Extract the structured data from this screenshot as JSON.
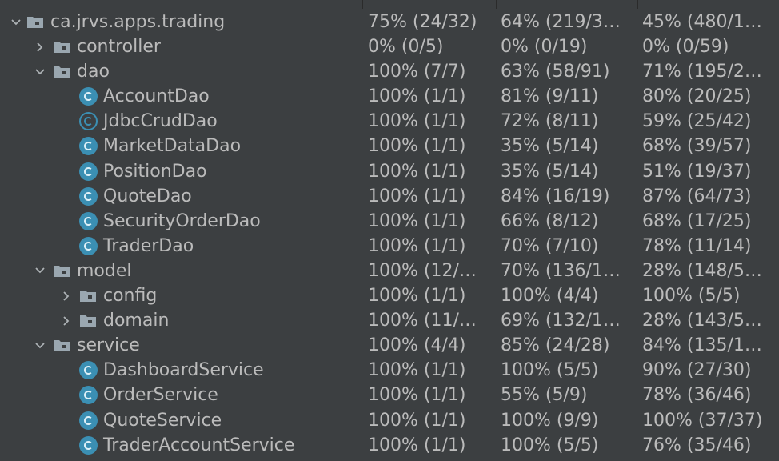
{
  "rows": [
    {
      "level": 0,
      "kind": "package",
      "expander": "expanded",
      "name": "ca.jrvs.apps.trading",
      "class_cov": "75% (24/32)",
      "method_cov": "64% (219/3…",
      "line_cov": "45% (480/1…"
    },
    {
      "level": 1,
      "kind": "package",
      "expander": "collapsed",
      "name": "controller",
      "class_cov": "0% (0/5)",
      "method_cov": "0% (0/19)",
      "line_cov": "0% (0/59)"
    },
    {
      "level": 1,
      "kind": "package",
      "expander": "expanded",
      "name": "dao",
      "class_cov": "100% (7/7)",
      "method_cov": "63% (58/91)",
      "line_cov": "71% (195/2…"
    },
    {
      "level": 2,
      "kind": "class",
      "name": "AccountDao",
      "class_cov": "100% (1/1)",
      "method_cov": "81% (9/11)",
      "line_cov": "80% (20/25)"
    },
    {
      "level": 2,
      "kind": "abstract-class",
      "name": "JdbcCrudDao",
      "class_cov": "100% (1/1)",
      "method_cov": "72% (8/11)",
      "line_cov": "59% (25/42)"
    },
    {
      "level": 2,
      "kind": "class",
      "name": "MarketDataDao",
      "class_cov": "100% (1/1)",
      "method_cov": "35% (5/14)",
      "line_cov": "68% (39/57)"
    },
    {
      "level": 2,
      "kind": "class",
      "name": "PositionDao",
      "class_cov": "100% (1/1)",
      "method_cov": "35% (5/14)",
      "line_cov": "51% (19/37)"
    },
    {
      "level": 2,
      "kind": "class",
      "name": "QuoteDao",
      "class_cov": "100% (1/1)",
      "method_cov": "84% (16/19)",
      "line_cov": "87% (64/73)"
    },
    {
      "level": 2,
      "kind": "class",
      "name": "SecurityOrderDao",
      "class_cov": "100% (1/1)",
      "method_cov": "66% (8/12)",
      "line_cov": "68% (17/25)"
    },
    {
      "level": 2,
      "kind": "class",
      "name": "TraderDao",
      "class_cov": "100% (1/1)",
      "method_cov": "70% (7/10)",
      "line_cov": "78% (11/14)"
    },
    {
      "level": 1,
      "kind": "package",
      "expander": "expanded",
      "name": "model",
      "class_cov": "100% (12/…",
      "method_cov": "70% (136/1…",
      "line_cov": "28% (148/5…"
    },
    {
      "level": 2,
      "kind": "package",
      "expander": "collapsed",
      "name": "config",
      "class_cov": "100% (1/1)",
      "method_cov": "100% (4/4)",
      "line_cov": "100% (5/5)"
    },
    {
      "level": 2,
      "kind": "package",
      "expander": "collapsed",
      "name": "domain",
      "class_cov": "100% (11/…",
      "method_cov": "69% (132/1…",
      "line_cov": "28% (143/5…"
    },
    {
      "level": 1,
      "kind": "package",
      "expander": "expanded",
      "name": "service",
      "class_cov": "100% (4/4)",
      "method_cov": "85% (24/28)",
      "line_cov": "84% (135/1…"
    },
    {
      "level": 2,
      "kind": "class",
      "name": "DashboardService",
      "class_cov": "100% (1/1)",
      "method_cov": "100% (5/5)",
      "line_cov": "90% (27/30)"
    },
    {
      "level": 2,
      "kind": "class",
      "name": "OrderService",
      "class_cov": "100% (1/1)",
      "method_cov": "55% (5/9)",
      "line_cov": "78% (36/46)"
    },
    {
      "level": 2,
      "kind": "class",
      "name": "QuoteService",
      "class_cov": "100% (1/1)",
      "method_cov": "100% (9/9)",
      "line_cov": "100% (37/37)"
    },
    {
      "level": 2,
      "kind": "class",
      "name": "TraderAccountService",
      "class_cov": "100% (1/1)",
      "method_cov": "100% (5/5)",
      "line_cov": "76% (35/46)"
    }
  ],
  "colors": {
    "background": "#3c3f41",
    "text": "#bbbbbb",
    "class_icon": "#3b8fb3",
    "folder_icon": "#9aa7b0"
  },
  "icons": {
    "package": "folder-icon",
    "class": "class-icon",
    "abstract-class": "abstract-class-icon",
    "expanded": "chevron-down-icon",
    "collapsed": "chevron-right-icon"
  }
}
